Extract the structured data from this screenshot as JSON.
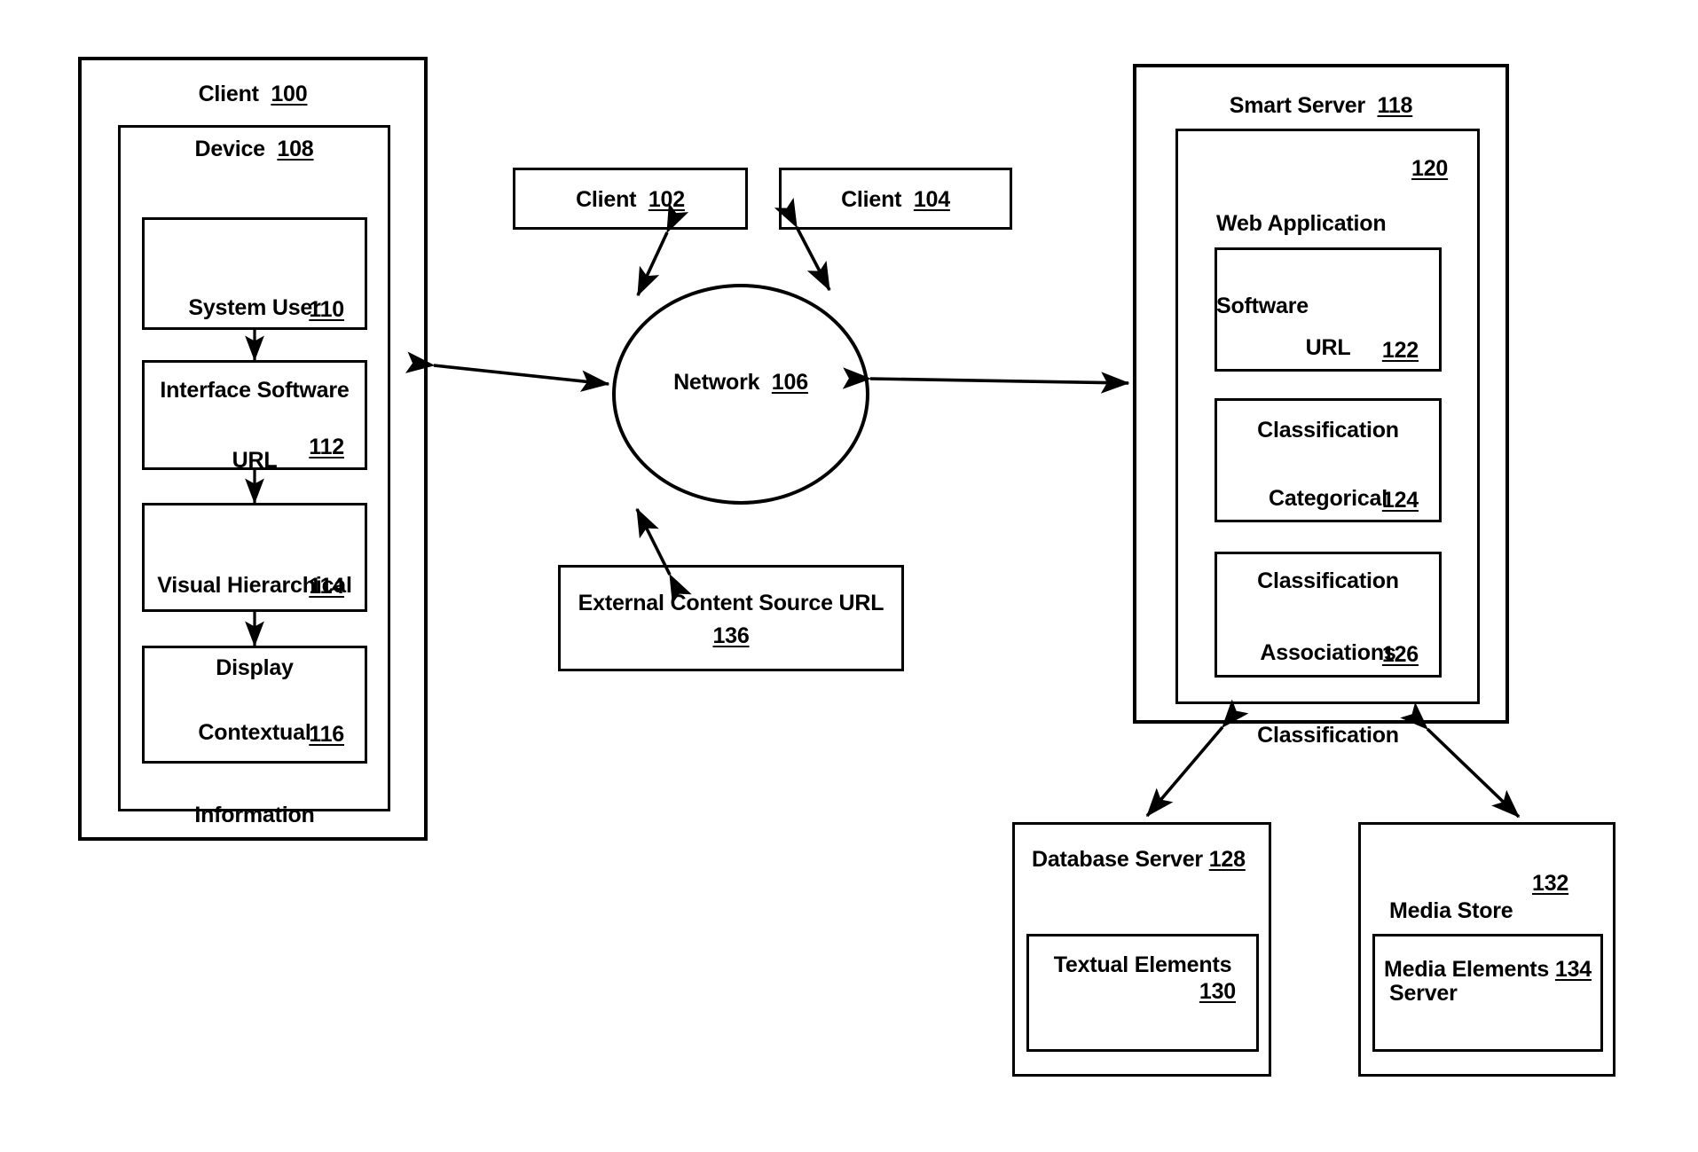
{
  "diagram": {
    "type": "system-architecture-block-diagram",
    "client_100": {
      "title_text": "Client",
      "title_num": "100",
      "device": {
        "title_text": "Device",
        "title_num": "108",
        "modules": [
          {
            "line1": "System User",
            "line2": "Interface Software",
            "num": "110"
          },
          {
            "line1": "URL",
            "line2": "",
            "num": "112"
          },
          {
            "line1": "Visual Hierarchical",
            "line2": "Display",
            "num": "114"
          },
          {
            "line1": "Contextual",
            "line2": "Information",
            "num": "116"
          }
        ]
      }
    },
    "clients": [
      {
        "label": "Client",
        "num": "102"
      },
      {
        "label": "Client",
        "num": "104"
      }
    ],
    "network": {
      "label": "Network",
      "num": "106"
    },
    "external_source": {
      "label": "External Content Source URL",
      "num": "136"
    },
    "smart_server": {
      "title_text": "Smart Server",
      "title_num": "118",
      "web_app": {
        "line1": "Web Application",
        "line2": "Software",
        "num": "120",
        "classifiers": [
          {
            "line1": "URL",
            "line2": "Classification",
            "num": "122"
          },
          {
            "line1": "Categorical",
            "line2": "Classification",
            "num": "124"
          },
          {
            "line1": "Associations",
            "line2": "Classification",
            "num": "126"
          }
        ]
      }
    },
    "database_server": {
      "title_text": "Database Server",
      "title_num": "128",
      "store": {
        "label": "Textual Elements",
        "num": "130"
      }
    },
    "media_store_server": {
      "title_line1": "Media Store",
      "title_line2": "Server",
      "title_num": "132",
      "store": {
        "label": "Media Elements",
        "num": "134"
      }
    },
    "colors": {
      "stroke": "#000000",
      "background": "#ffffff"
    }
  }
}
